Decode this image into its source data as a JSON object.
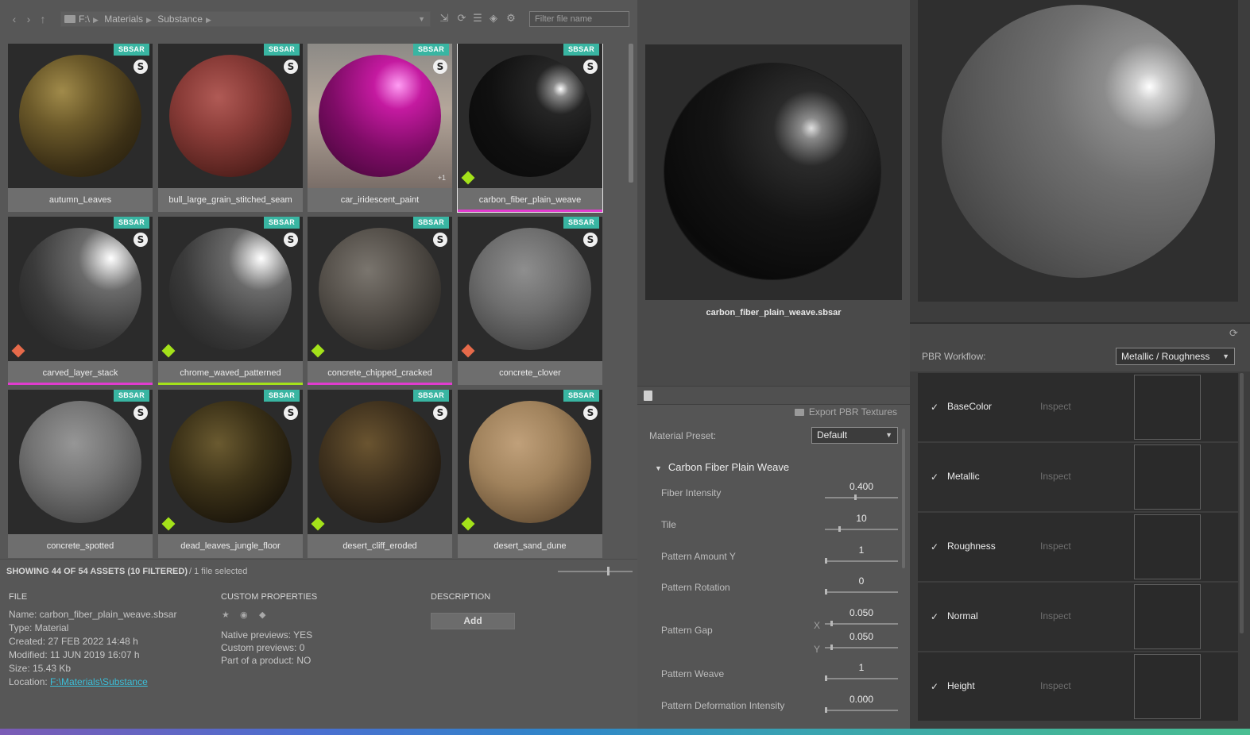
{
  "toolbar": {
    "path": [
      "F:\\",
      "Materials",
      "Substance"
    ],
    "filter_placeholder": "Filter file name"
  },
  "grid": {
    "items": [
      {
        "label": "autumn_Leaves",
        "badge": "SBSAR",
        "state": "",
        "underline": ""
      },
      {
        "label": "bull_large_grain_stitched_seam",
        "badge": "SBSAR",
        "state": "",
        "underline": ""
      },
      {
        "label": "car_iridescent_paint",
        "badge": "SBSAR",
        "state": "",
        "underline": "",
        "extra": "+1"
      },
      {
        "label": "carbon_fiber_plain_weave",
        "badge": "SBSAR",
        "state": "#a4e21a",
        "underline": "#e13ccf",
        "selected": true
      },
      {
        "label": "carved_layer_stack",
        "badge": "SBSAR",
        "state": "#e66a4a",
        "underline": "#e13ccf"
      },
      {
        "label": "chrome_waved_patterned",
        "badge": "SBSAR",
        "state": "#a4e21a",
        "underline": "#a4e21a"
      },
      {
        "label": "concrete_chipped_cracked",
        "badge": "SBSAR",
        "state": "#a4e21a",
        "underline": "#e13ccf"
      },
      {
        "label": "concrete_clover",
        "badge": "SBSAR",
        "state": "#e66a4a",
        "underline": ""
      },
      {
        "label": "concrete_spotted",
        "badge": "SBSAR",
        "state": "",
        "underline": ""
      },
      {
        "label": "dead_leaves_jungle_floor",
        "badge": "SBSAR",
        "state": "#a4e21a",
        "underline": ""
      },
      {
        "label": "desert_cliff_eroded",
        "badge": "SBSAR",
        "state": "#a4e21a",
        "underline": ""
      },
      {
        "label": "desert_sand_dune",
        "badge": "SBSAR",
        "state": "#a4e21a",
        "underline": ""
      }
    ]
  },
  "status": {
    "count": "SHOWING 44 OF 54 ASSETS (10 FILTERED)",
    "selection": "/  1 file selected"
  },
  "info": {
    "file_header": "FILE",
    "name": "Name: carbon_fiber_plain_weave.sbsar",
    "type": "Type: Material",
    "created": "Created: 27 FEB 2022 14:48 h",
    "modified": "Modified: 11 JUN 2019 16:07 h",
    "size": "Size: 15.43 Kb",
    "location_label": "Location:",
    "location_link": "F:\\Materials\\Substance",
    "custom_header": "CUSTOM PROPERTIES",
    "native_previews": "Native previews: YES",
    "custom_previews": "Custom previews: 0",
    "part_of_product": "Part of a product: NO",
    "desc_header": "DESCRIPTION",
    "add_label": "Add"
  },
  "preview": {
    "name": "carbon_fiber_plain_weave.sbsar"
  },
  "params": {
    "export_label": "Export PBR Textures",
    "preset_label": "Material Preset:",
    "preset_value": "Default",
    "group_title": "Carbon Fiber Plain Weave",
    "items": [
      {
        "label": "Fiber Intensity",
        "value": "0.400",
        "pos": 0.4
      },
      {
        "label": "Tile",
        "value": "10",
        "pos": 0.18
      },
      {
        "label": "Pattern Amount Y",
        "value": "1",
        "pos": 0.0
      },
      {
        "label": "Pattern Rotation",
        "value": "0",
        "pos": 0.0
      },
      {
        "label": "Pattern Gap",
        "x_value": "0.050",
        "y_value": "0.050",
        "pos": 0.05
      },
      {
        "label": "Pattern Weave",
        "value": "1",
        "pos": 0.0
      },
      {
        "label": "Pattern Deformation Intensity",
        "value": "0.000",
        "pos": 0.0
      }
    ],
    "x_label": "X",
    "y_label": "Y"
  },
  "pbr": {
    "workflow_label": "PBR Workflow:",
    "workflow_value": "Metallic / Roughness",
    "inspect_label": "Inspect",
    "maps": [
      "BaseColor",
      "Metallic",
      "Roughness",
      "Normal",
      "Height"
    ]
  }
}
